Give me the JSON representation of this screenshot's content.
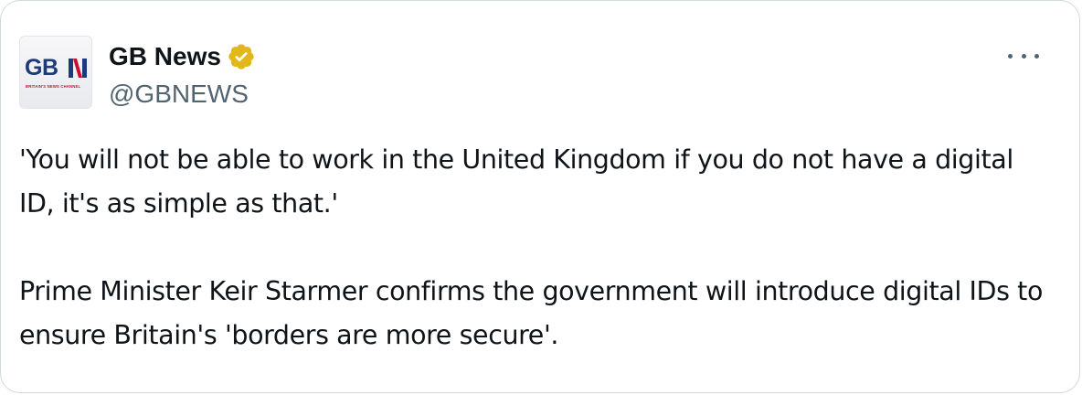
{
  "author": {
    "display_name": "GB News",
    "handle": "@GBNEWS",
    "verified_icon": "verified-gold-badge-icon",
    "avatar": {
      "logo_text": "GB",
      "tagline": "BRITAIN'S NEWS CHANNEL",
      "colors": {
        "navy": "#1d3a7a",
        "red": "#c8102e"
      }
    }
  },
  "tweet": {
    "paragraphs": [
      "'You will not be able to work in the United Kingdom if you do not have a digital ID, it's as simple as that.'",
      "Prime Minister Keir Starmer confirms the government will introduce digital IDs to ensure Britain's 'borders are more secure'."
    ]
  },
  "menu": {
    "icon": "more-options-icon"
  },
  "colors": {
    "text_primary": "#0f1419",
    "text_secondary": "#536471",
    "verified_gold": "#e2b719",
    "border": "#cfd9de"
  }
}
